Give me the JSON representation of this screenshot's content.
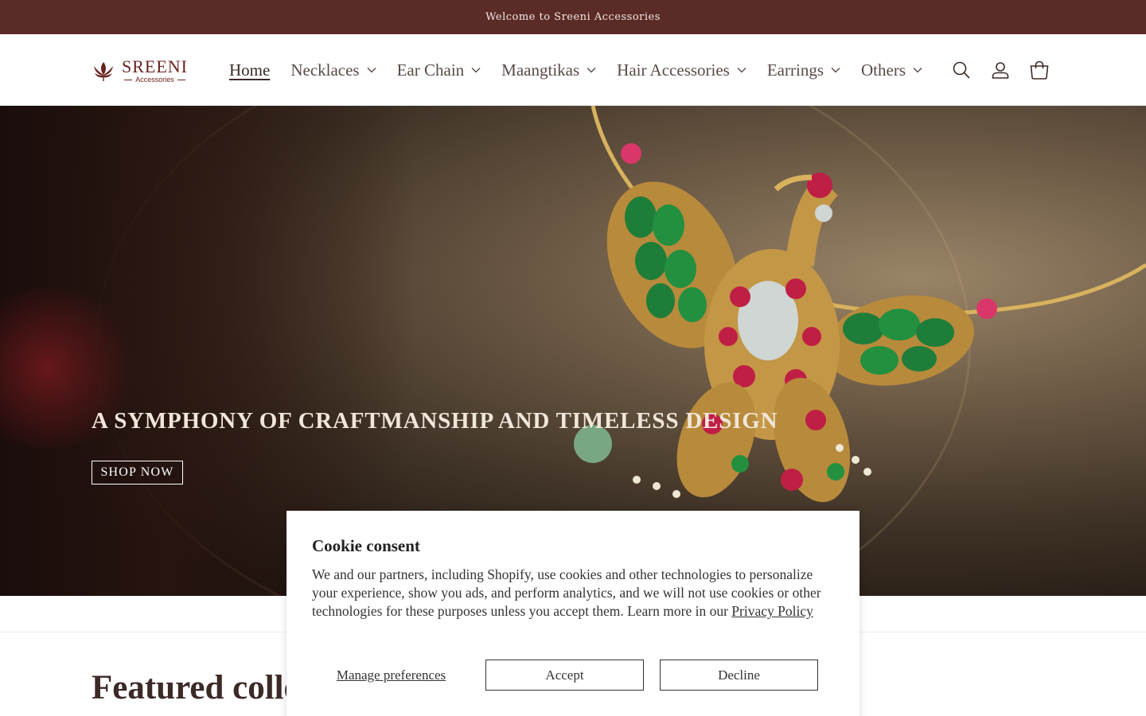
{
  "announcement": {
    "text": "Welcome to Sreeni Accessories"
  },
  "brand": {
    "name": "SREENI",
    "tagline": "Accessories"
  },
  "nav": {
    "items": [
      {
        "label": "Home",
        "active": true,
        "has_dropdown": false
      },
      {
        "label": "Necklaces",
        "active": false,
        "has_dropdown": true
      },
      {
        "label": "Ear Chain",
        "active": false,
        "has_dropdown": true
      },
      {
        "label": "Maangtikas",
        "active": false,
        "has_dropdown": true
      },
      {
        "label": "Hair Accessories",
        "active": false,
        "has_dropdown": true
      },
      {
        "label": "Earrings",
        "active": false,
        "has_dropdown": true
      },
      {
        "label": "Others",
        "active": false,
        "has_dropdown": true
      }
    ]
  },
  "header_icons": [
    "search-icon",
    "account-icon",
    "cart-icon"
  ],
  "hero": {
    "title": "A SYMPHONY OF CRAFTMANSHIP AND TIMELESS DESIGN",
    "button_label": "SHOP NOW"
  },
  "featured": {
    "title": "Featured collection"
  },
  "cookie": {
    "title": "Cookie consent",
    "body": "We and our partners, including Shopify, use cookies and other technologies to personalize your experience, show you ads, and perform analytics, and we will not use cookies or other technologies for these purposes unless you accept them. Learn more in our",
    "link": "Privacy Policy",
    "manage_label": "Manage preferences",
    "accept_label": "Accept",
    "decline_label": "Decline"
  },
  "colors": {
    "announcement_bg": "#5b2b27",
    "brand": "#6a2320",
    "text": "#3b2a26"
  }
}
